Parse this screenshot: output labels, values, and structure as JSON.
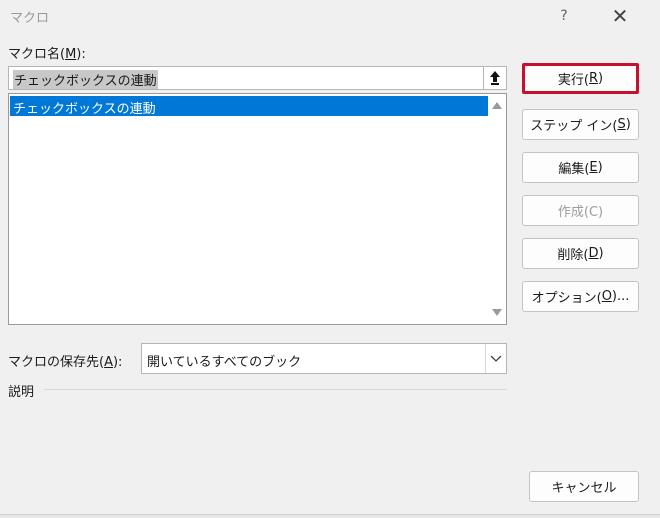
{
  "dialog": {
    "title": "マクロ",
    "help_label": "?",
    "close_label": "✕"
  },
  "macro_name": {
    "label_prefix": "マクロ名(",
    "label_key": "M",
    "label_suffix": "):",
    "value": "チェックボックスの連動"
  },
  "macro_list": {
    "items": [
      {
        "label": "チェックボックスの連動",
        "selected": true
      }
    ]
  },
  "buttons": {
    "run": {
      "prefix": "実行(",
      "key": "R",
      "suffix": ")"
    },
    "step_in": {
      "prefix": "ステップ イン(",
      "key": "S",
      "suffix": ")"
    },
    "edit": {
      "prefix": "編集(",
      "key": "E",
      "suffix": ")"
    },
    "create": {
      "label": "作成(C)"
    },
    "delete": {
      "prefix": "削除(",
      "key": "D",
      "suffix": ")"
    },
    "options": {
      "prefix": "オプション(",
      "key": "O",
      "suffix": ")..."
    },
    "cancel": {
      "label": "キャンセル"
    }
  },
  "location": {
    "label_prefix": "マクロの保存先(",
    "label_key": "A",
    "label_suffix": "):",
    "selected": "開いているすべてのブック"
  },
  "description": {
    "label": "説明"
  },
  "colors": {
    "selection": "#0078d7",
    "highlight_border": "#c8102e"
  }
}
